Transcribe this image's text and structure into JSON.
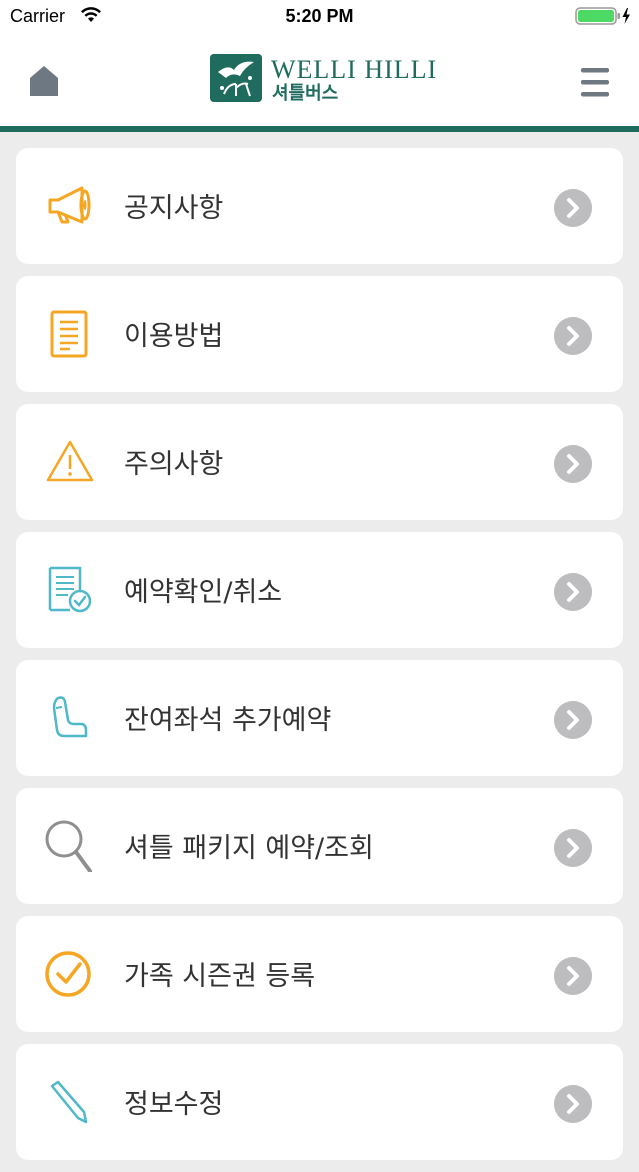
{
  "status_bar": {
    "carrier": "Carrier",
    "time": "5:20 PM"
  },
  "header": {
    "logo_title": "WELLI HILLI",
    "logo_subtitle": "셔틀버스",
    "brand_color": "#1f6b5e"
  },
  "menu": {
    "items": [
      {
        "label": "공지사항",
        "icon": "megaphone-icon"
      },
      {
        "label": "이용방법",
        "icon": "document-icon"
      },
      {
        "label": "주의사항",
        "icon": "warning-icon"
      },
      {
        "label": "예약확인/취소",
        "icon": "document-check-icon"
      },
      {
        "label": "잔여좌석 추가예약",
        "icon": "seat-icon"
      },
      {
        "label": "셔틀 패키지 예약/조회",
        "icon": "search-icon"
      },
      {
        "label": "가족 시즌권 등록",
        "icon": "check-circle-icon"
      },
      {
        "label": "정보수정",
        "icon": "pencil-icon"
      }
    ]
  },
  "colors": {
    "accent_orange": "#f5a623",
    "accent_teal": "#4fb8c9",
    "icon_gray": "#8f8f8f",
    "chevron_gray": "#bdbdbf",
    "background": "#ececed"
  }
}
